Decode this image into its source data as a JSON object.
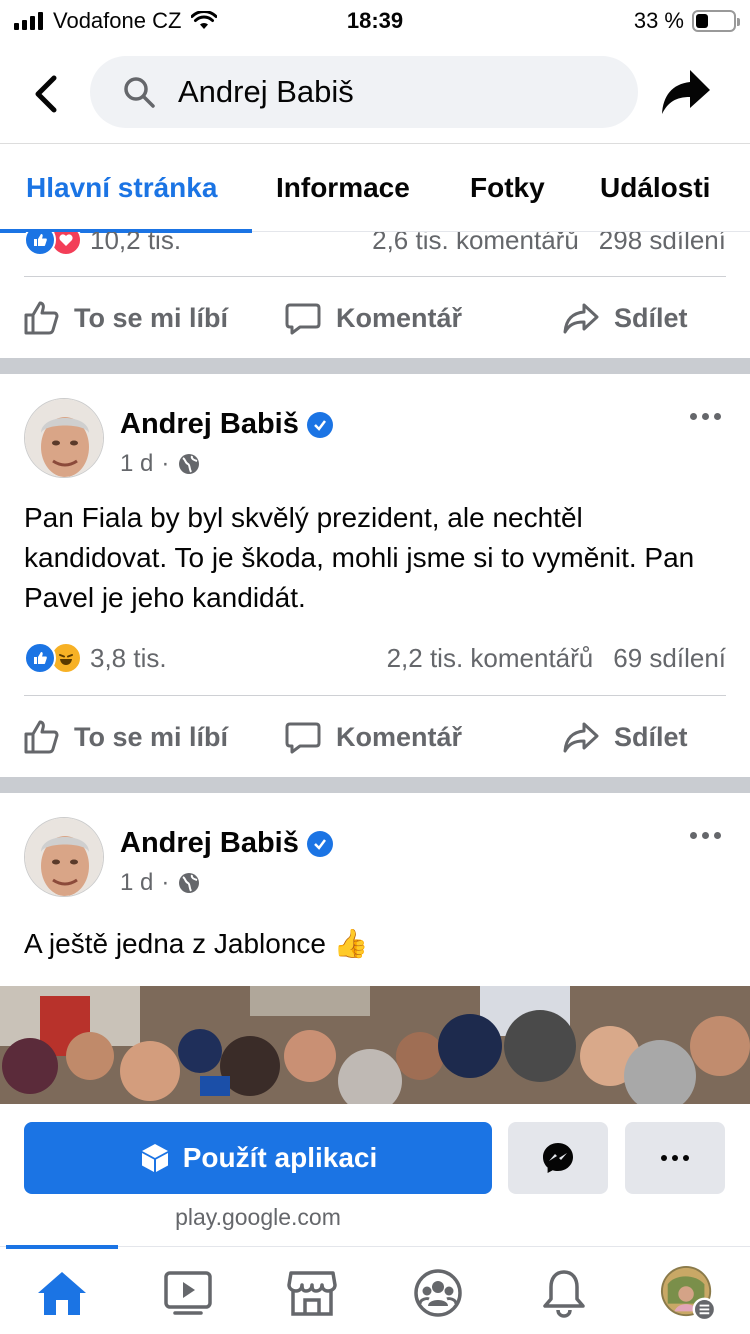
{
  "status_bar": {
    "carrier": "Vodafone CZ",
    "time": "18:39",
    "battery": "33 %",
    "battery_level": 0.33
  },
  "header": {
    "search_text": "Andrej Babiš"
  },
  "tabs": [
    {
      "label": "Hlavní stránka",
      "active": true
    },
    {
      "label": "Informace"
    },
    {
      "label": "Fotky"
    },
    {
      "label": "Události"
    }
  ],
  "prev_post": {
    "reactions": "10,2 tis.",
    "comments": "2,6 tis. komentářů",
    "shares": "298 sdílení"
  },
  "actions": {
    "like": "To se mi líbí",
    "comment": "Komentář",
    "share": "Sdílet"
  },
  "posts": [
    {
      "author": "Andrej Babiš",
      "time": "1 d",
      "separator": "·",
      "text": "Pan Fiala by byl skvělý prezident, ale nechtěl kandidovat. To je škoda, mohli jsme si to vyměnit. Pan Pavel je jeho kandidát.",
      "reactions": "3,8 tis.",
      "comments": "2,2 tis. komentářů",
      "shares": "69 sdílení"
    },
    {
      "author": "Andrej Babiš",
      "time": "1 d",
      "separator": "·",
      "text": "A ještě jedna z Jablonce 👍"
    }
  ],
  "banner": {
    "use_app": "Použít aplikaci",
    "domain": "play.google.com"
  },
  "colors": {
    "accent": "#1b74e4",
    "secondary_text": "#65676b",
    "separator": "#c9ccd1"
  }
}
